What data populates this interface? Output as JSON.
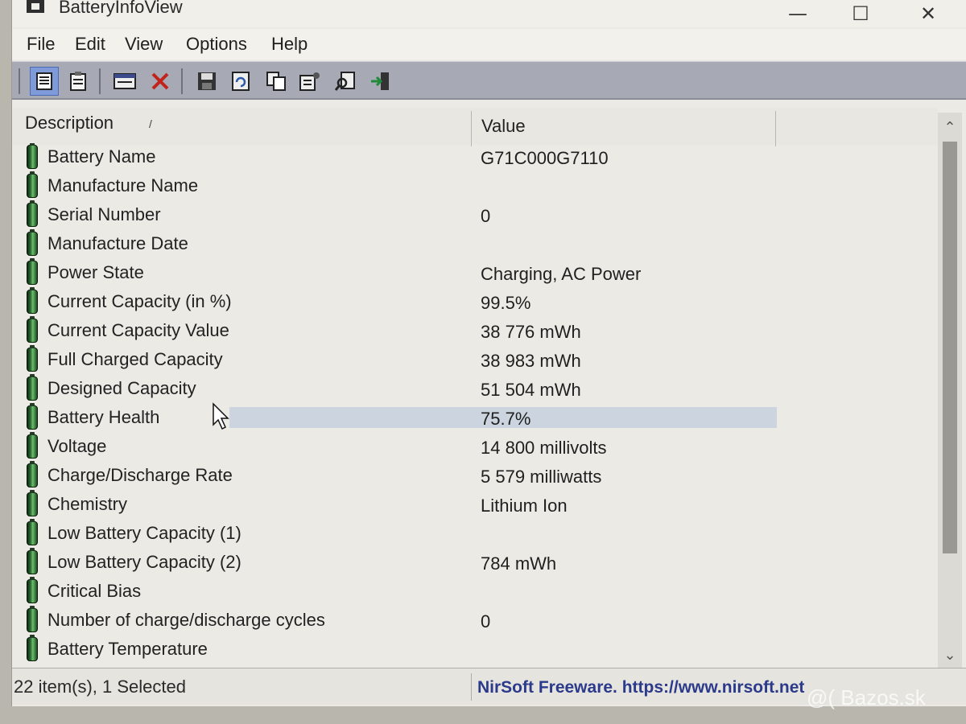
{
  "window": {
    "title": "BatteryInfoView",
    "controls": {
      "minimize": "—",
      "maximize": "☐",
      "close": "✕"
    }
  },
  "menu": [
    "File",
    "Edit",
    "View",
    "Options",
    "Help"
  ],
  "toolbar": {
    "buttons": [
      "details-view-icon",
      "report-view-icon",
      "properties-icon",
      "delete-icon",
      "save-icon",
      "refresh-icon",
      "copy-icon",
      "options-icon",
      "find-icon",
      "exit-icon"
    ]
  },
  "columns": {
    "description": "Description",
    "value": "Value"
  },
  "rows": [
    {
      "desc": "Battery Name",
      "value": "G71C000G7110"
    },
    {
      "desc": "Manufacture Name",
      "value": ""
    },
    {
      "desc": "Serial Number",
      "value": "0"
    },
    {
      "desc": "Manufacture Date",
      "value": ""
    },
    {
      "desc": "Power State",
      "value": "Charging, AC Power"
    },
    {
      "desc": "Current Capacity (in %)",
      "value": "99.5%"
    },
    {
      "desc": "Current Capacity Value",
      "value": "38 776 mWh"
    },
    {
      "desc": "Full Charged Capacity",
      "value": "38 983 mWh"
    },
    {
      "desc": "Designed Capacity",
      "value": "51 504 mWh"
    },
    {
      "desc": "Battery Health",
      "value": "75.7%"
    },
    {
      "desc": "Voltage",
      "value": "14 800 millivolts"
    },
    {
      "desc": "Charge/Discharge Rate",
      "value": "5 579 milliwatts"
    },
    {
      "desc": "Chemistry",
      "value": "Lithium Ion"
    },
    {
      "desc": "Low Battery Capacity (1)",
      "value": ""
    },
    {
      "desc": "Low Battery Capacity (2)",
      "value": "784 mWh"
    },
    {
      "desc": "Critical Bias",
      "value": ""
    },
    {
      "desc": "Number of charge/discharge cycles",
      "value": "0"
    },
    {
      "desc": "Battery Temperature",
      "value": ""
    }
  ],
  "selected_row": "Battery Health",
  "status": {
    "items": "22 item(s), 1 Selected",
    "link": "NirSoft Freeware. https://www.nirsoft.net"
  },
  "watermark": "@( Bazos.sk",
  "colors": {
    "accent_link": "#2b3a8a",
    "battery_icon": "#2f6e36",
    "toolbar": "#a7a9b5"
  }
}
